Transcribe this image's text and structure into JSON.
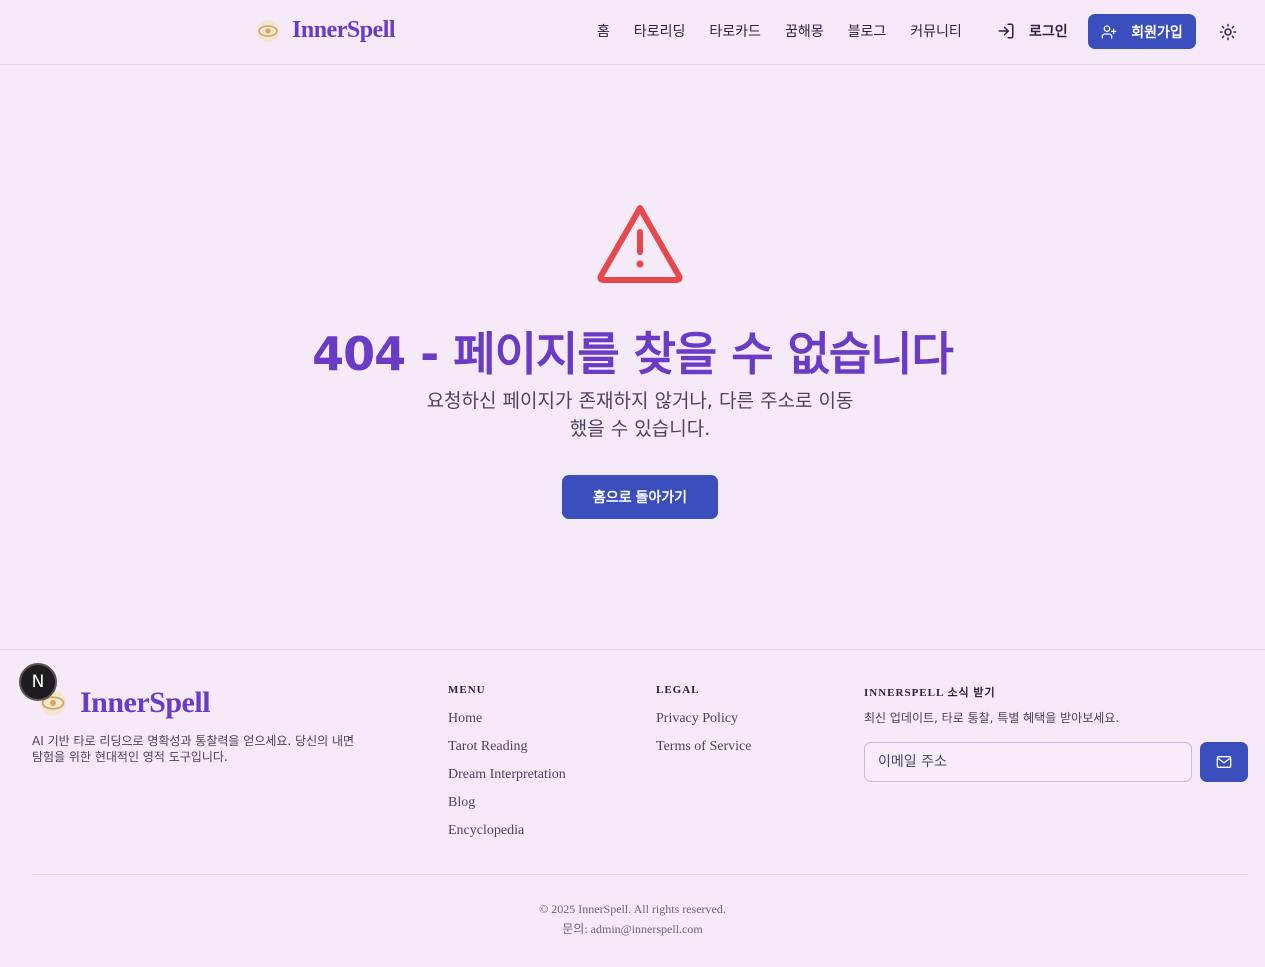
{
  "header": {
    "brand": "InnerSpell",
    "nav": [
      "홈",
      "타로리딩",
      "타로카드",
      "꿈해몽",
      "블로그",
      "커뮤니티"
    ],
    "login_label": "로그인",
    "signup_label": "회원가입"
  },
  "main": {
    "title": "404 - 페이지를 찾을 수 없습니다",
    "description_line1": "요청하신 페이지가 존재하지 않거나, 다른 주소로 이동",
    "description_line2": "했을 수 있습니다.",
    "home_button": "홈으로 돌아가기"
  },
  "footer": {
    "badge": "N",
    "brand": "InnerSpell",
    "tagline": "AI 기반 타로 리딩으로 명확성과 통찰력을 얻으세요. 당신의 내면 탐험을 위한 현대적인 영적 도구입니다.",
    "menu": {
      "heading": "MENU",
      "items": [
        "Home",
        "Tarot Reading",
        "Dream Interpretation",
        "Blog",
        "Encyclopedia"
      ]
    },
    "legal": {
      "heading": "LEGAL",
      "items": [
        "Privacy Policy",
        "Terms of Service"
      ]
    },
    "newsletter": {
      "heading": "INNERSPELL 소식 받기",
      "text": "최신 업데이트, 타로 통찰, 특별 혜택을 받아보세요.",
      "placeholder": "이메일 주소"
    },
    "copyright": "© 2025 InnerSpell. All rights reserved.",
    "contact": "문의: admin@innerspell.com"
  },
  "colors": {
    "background": "#f6eaf8",
    "brand_purple": "#6a3bc5",
    "primary_button": "#3a4fbd",
    "warning_red": "#e5484d"
  }
}
